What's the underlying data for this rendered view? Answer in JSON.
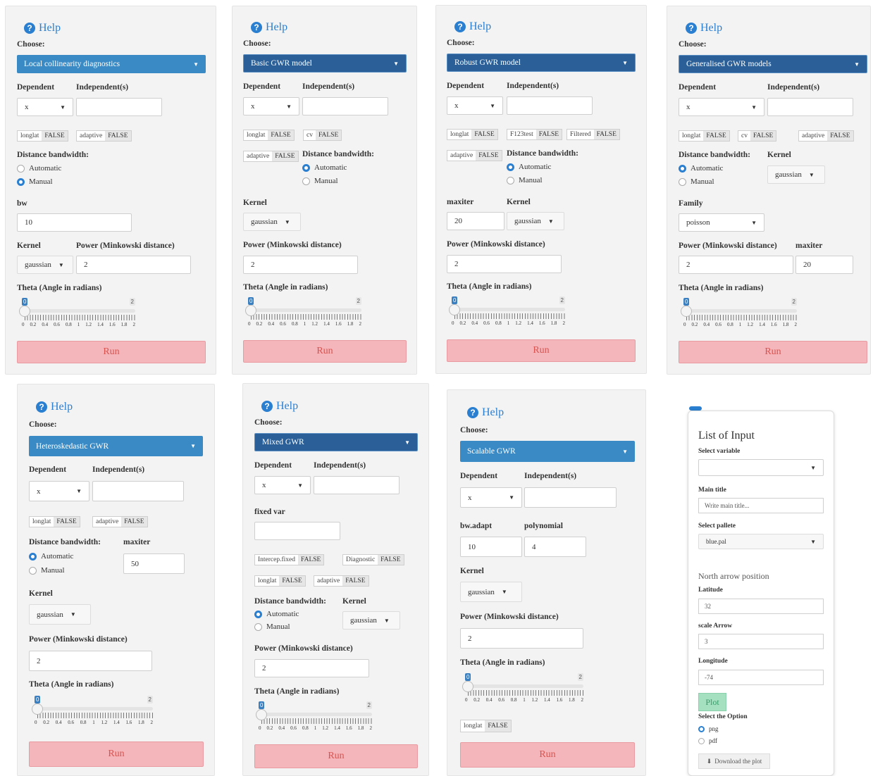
{
  "common": {
    "help": "Help",
    "choose": "Choose:",
    "dependent": "Dependent",
    "independent": "Independent(s)",
    "distance_bandwidth": "Distance bandwidth:",
    "automatic": "Automatic",
    "manual": "Manual",
    "kernel": "Kernel",
    "power": "Power (Minkowski distance)",
    "theta": "Theta (Angle in radians)",
    "run": "Run",
    "false": "FALSE",
    "x": "x",
    "gaussian": "gaussian",
    "slider_val": "0",
    "slider_max": "2",
    "slider_ticks": [
      "0",
      "0.2",
      "0.4",
      "0.6",
      "0.8",
      "1",
      "1.2",
      "1.4",
      "1.6",
      "1.8",
      "2"
    ]
  },
  "p1": {
    "model": "Local collinearity diagnostics",
    "longlat": "longlat",
    "adaptive": "adaptive",
    "bw_label": "bw",
    "bw_value": "10",
    "power_value": "2"
  },
  "p2": {
    "model": "Basic GWR model",
    "longlat": "longlat",
    "cv": "cv",
    "adaptive": "adaptive",
    "power_value": "2"
  },
  "p3": {
    "model": "Robust GWR model",
    "longlat": "longlat",
    "f123": "F123test",
    "filtered": "Filtered",
    "adaptive": "adaptive",
    "maxiter_label": "maxiter",
    "maxiter_value": "20",
    "power_value": "2"
  },
  "p4": {
    "model": "Generalised GWR models",
    "longlat": "longlat",
    "cv": "cv",
    "adaptive": "adaptive",
    "family_label": "Family",
    "family_value": "poisson",
    "maxiter_label": "maxiter",
    "maxiter_value": "20",
    "power_value": "2"
  },
  "p5": {
    "model": "Heteroskedastic GWR",
    "longlat": "longlat",
    "adaptive": "adaptive",
    "maxiter_label": "maxiter",
    "maxiter_value": "50",
    "power_value": "2"
  },
  "p6": {
    "model": "Mixed GWR",
    "fixed_var": "fixed var",
    "intercep": "Intercep.fixed",
    "diagnostic": "Diagnostic",
    "longlat": "longlat",
    "adaptive": "adaptive",
    "power_value": "2"
  },
  "p7": {
    "model": "Scalable GWR",
    "bw_adapt_label": "bw.adapt",
    "bw_adapt_value": "10",
    "polynomial_label": "polynomial",
    "polynomial_value": "4",
    "power_value": "2",
    "longlat": "longlat"
  },
  "p8": {
    "title": "List of Input",
    "select_variable": "Select variable",
    "main_title_label": "Main title",
    "main_title_placeholder": "Write main title...",
    "select_pallete": "Select pallete",
    "pallete_value": "blue.pal",
    "north_arrow": "North arrow position",
    "latitude_label": "Latitude",
    "latitude_value": "32",
    "scale_arrow_label": "scale Arrow",
    "scale_arrow_value": "3",
    "longitude_label": "Longitude",
    "longitude_value": "-74",
    "plot_button": "Plot",
    "select_option": "Select the Option",
    "opt_png": "png",
    "opt_pdf": "pdf",
    "download": "Download the plot"
  }
}
